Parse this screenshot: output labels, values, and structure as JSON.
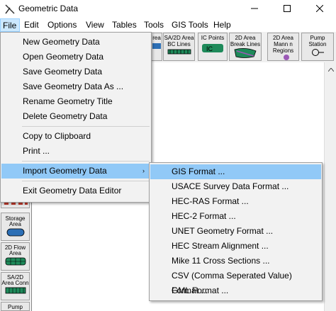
{
  "window": {
    "title": "Geometric Data",
    "app_icon": "geometry-app-icon",
    "controls": {
      "minimize": "minimize-icon",
      "maximize": "maximize-icon",
      "close": "close-icon"
    }
  },
  "menubar": {
    "items": [
      "File",
      "Edit",
      "Options",
      "View",
      "Tables",
      "Tools",
      "GIS Tools",
      "Help"
    ]
  },
  "toolbar": {
    "buttons": [
      {
        "label": "rea",
        "icon": "storage-area-icon"
      },
      {
        "label": "SA/2D Area BC Lines",
        "icon": "bc-lines-icon"
      },
      {
        "label": "IC Points",
        "icon": "ic-points-icon"
      },
      {
        "label": "2D Area Break Lines",
        "icon": "break-lines-icon"
      },
      {
        "label": "2D Area Mann n Regions",
        "icon": "mann-regions-icon"
      },
      {
        "label": "Pump Station",
        "icon": "pump-station-icon"
      }
    ]
  },
  "toolbox": {
    "buttons": [
      {
        "label": "Storage Area",
        "icon": "storage-area-icon"
      },
      {
        "label": "2D Flow Area",
        "icon": "flow-area-icon"
      },
      {
        "label": "SA/2D Area Conn",
        "icon": "area-connection-icon"
      },
      {
        "label": "Pump",
        "icon": "pump-icon"
      }
    ]
  },
  "file_menu": {
    "items": [
      "New Geometry Data",
      "Open Geometry Data",
      "Save Geometry Data",
      "Save Geometry Data As ...",
      "Rename Geometry Title",
      "Delete Geometry Data",
      "Copy to Clipboard",
      "Print ...",
      "Import Geometry Data",
      "Exit Geometry Data Editor"
    ],
    "highlighted": "Import Geometry Data",
    "submenu_arrow": "›"
  },
  "import_submenu": {
    "items": [
      "GIS Format ...",
      "USACE Survey Data Format ...",
      "HEC-RAS Format ...",
      "HEC-2 Format ...",
      "UNET Geometry Format ...",
      "HEC Stream Alignment ...",
      "Mike 11 Cross Sections ...",
      "CSV (Comma Seperated Value) Format ...",
      "GML Format ..."
    ],
    "highlighted": "GIS Format ..."
  },
  "colors": {
    "menu_highlight": "#91c9f7",
    "file_menu_active": "#cce8ff",
    "icon_green": "#1e8a5a",
    "icon_blue": "#2c6fb5",
    "icon_purple": "#9b59b6"
  }
}
